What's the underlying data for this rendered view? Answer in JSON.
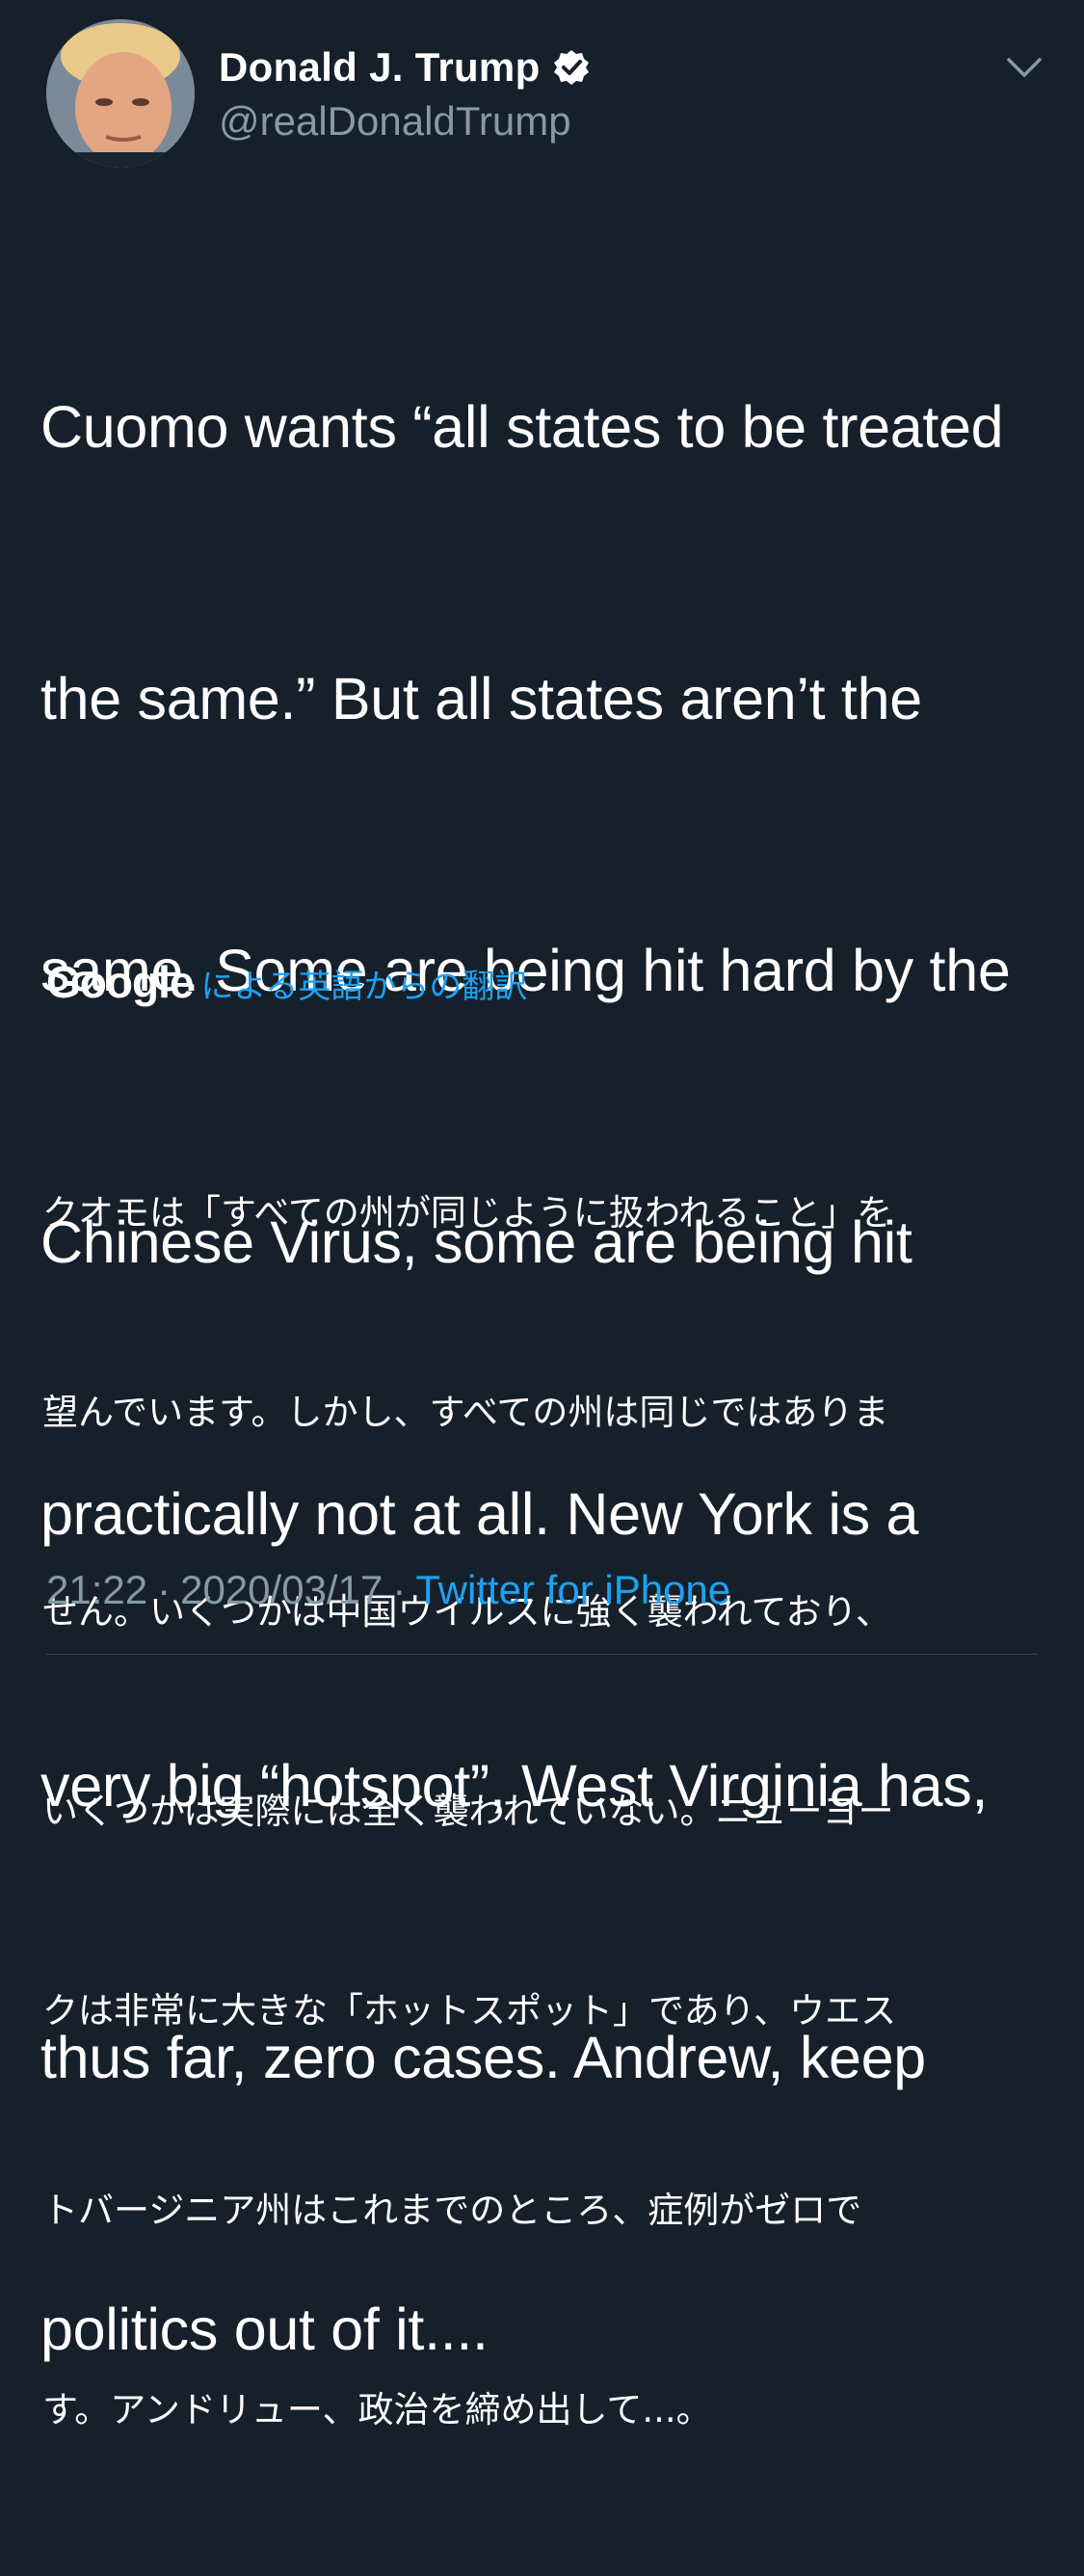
{
  "author": {
    "display_name": "Donald J. Trump",
    "handle": "@realDonaldTrump",
    "verified": true
  },
  "tweet": {
    "lines": [
      "Cuomo wants “all states to be treated",
      "the same.” But all states aren’t the",
      "same. Some are being hit hard by the",
      "Chinese Virus, some are being hit",
      "practically not at all. New York is a",
      "very big “hotspot”, West Virginia has,",
      "thus far, zero cases. Andrew, keep",
      "politics out of it...."
    ]
  },
  "translation": {
    "provider": "Google",
    "label": "による英語からの翻訳",
    "lines": [
      "クオモは「すべての州が同じように扱われること」を",
      "望んでいます。しかし、すべての州は同じではありま",
      "せん。いくつかは中国ウイルスに強く襲われており、",
      "いくつかは実際には全く襲われていない。ニューヨー",
      "クは非常に大きな「ホットスポット」であり、ウエス",
      "トバージニア州はこれまでのところ、症例がゼロで",
      "す。アンドリュー、政治を締め出して...。"
    ]
  },
  "meta": {
    "time": "21:22",
    "separator": "·",
    "date": "2020/03/17",
    "source": "Twitter for iPhone"
  },
  "colors": {
    "background": "#15202b",
    "secondary_text": "#8899a6",
    "link": "#1da1f2"
  },
  "icons": {
    "avatar": "profile-photo",
    "verified": "verified-badge-icon",
    "menu": "chevron-down-icon"
  }
}
